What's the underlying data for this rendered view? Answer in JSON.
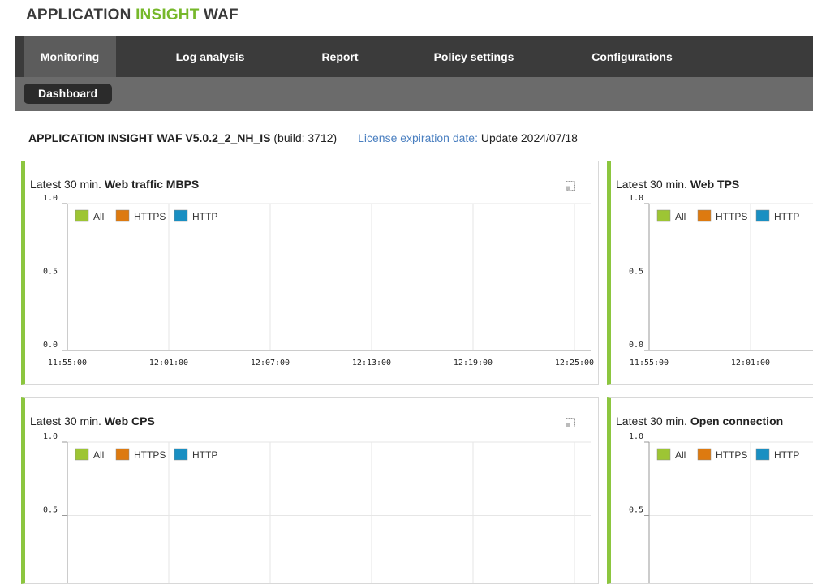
{
  "brand": {
    "part1": "APPLICATION",
    "part2": "INSIGHT",
    "part3": "WAF"
  },
  "nav": {
    "tabs": [
      {
        "label": "Monitoring",
        "active": true
      },
      {
        "label": "Log analysis"
      },
      {
        "label": "Report"
      },
      {
        "label": "Policy settings"
      },
      {
        "label": "Configurations"
      }
    ],
    "subtabs": [
      {
        "label": "Dashboard",
        "active": true
      }
    ]
  },
  "info": {
    "version": "APPLICATION INSIGHT WAF V5.0.2_2_NH_IS",
    "build": "(build: 3712)",
    "license_label": "License expiration date:",
    "license_value": "Update 2024/07/18"
  },
  "colors": {
    "all": "#9dc534",
    "https": "#dd7a10",
    "http": "#1a8fc2",
    "accent": "#8cc63f"
  },
  "chart_data": [
    {
      "type": "line",
      "title_prefix": "Latest 30 min.",
      "title": "Web traffic MBPS",
      "x": [
        "11:55:00",
        "12:01:00",
        "12:07:00",
        "12:13:00",
        "12:19:00",
        "12:25:00"
      ],
      "yticks": [
        "0.0",
        "0.5",
        "1.0"
      ],
      "ylim": [
        0,
        1
      ],
      "legend": [
        "All",
        "HTTPS",
        "HTTP"
      ],
      "series": []
    },
    {
      "type": "line",
      "title_prefix": "Latest 30 min.",
      "title": "Web TPS",
      "x": [
        "11:55:00",
        "12:01:00"
      ],
      "yticks": [
        "0.0",
        "0.5",
        "1.0"
      ],
      "ylim": [
        0,
        1
      ],
      "legend": [
        "All",
        "HTTPS",
        "HTTP"
      ],
      "series": []
    },
    {
      "type": "line",
      "title_prefix": "Latest 30 min.",
      "title": "Web CPS",
      "x": [],
      "yticks": [
        "0.5",
        "1.0"
      ],
      "ylim": [
        0,
        1
      ],
      "legend": [
        "All",
        "HTTPS",
        "HTTP"
      ],
      "series": []
    },
    {
      "type": "line",
      "title_prefix": "Latest 30 min.",
      "title": "Open connection",
      "x": [],
      "yticks": [
        "0.5",
        "1.0"
      ],
      "ylim": [
        0,
        1
      ],
      "legend": [
        "All",
        "HTTPS",
        "HTTP"
      ],
      "series": []
    }
  ]
}
